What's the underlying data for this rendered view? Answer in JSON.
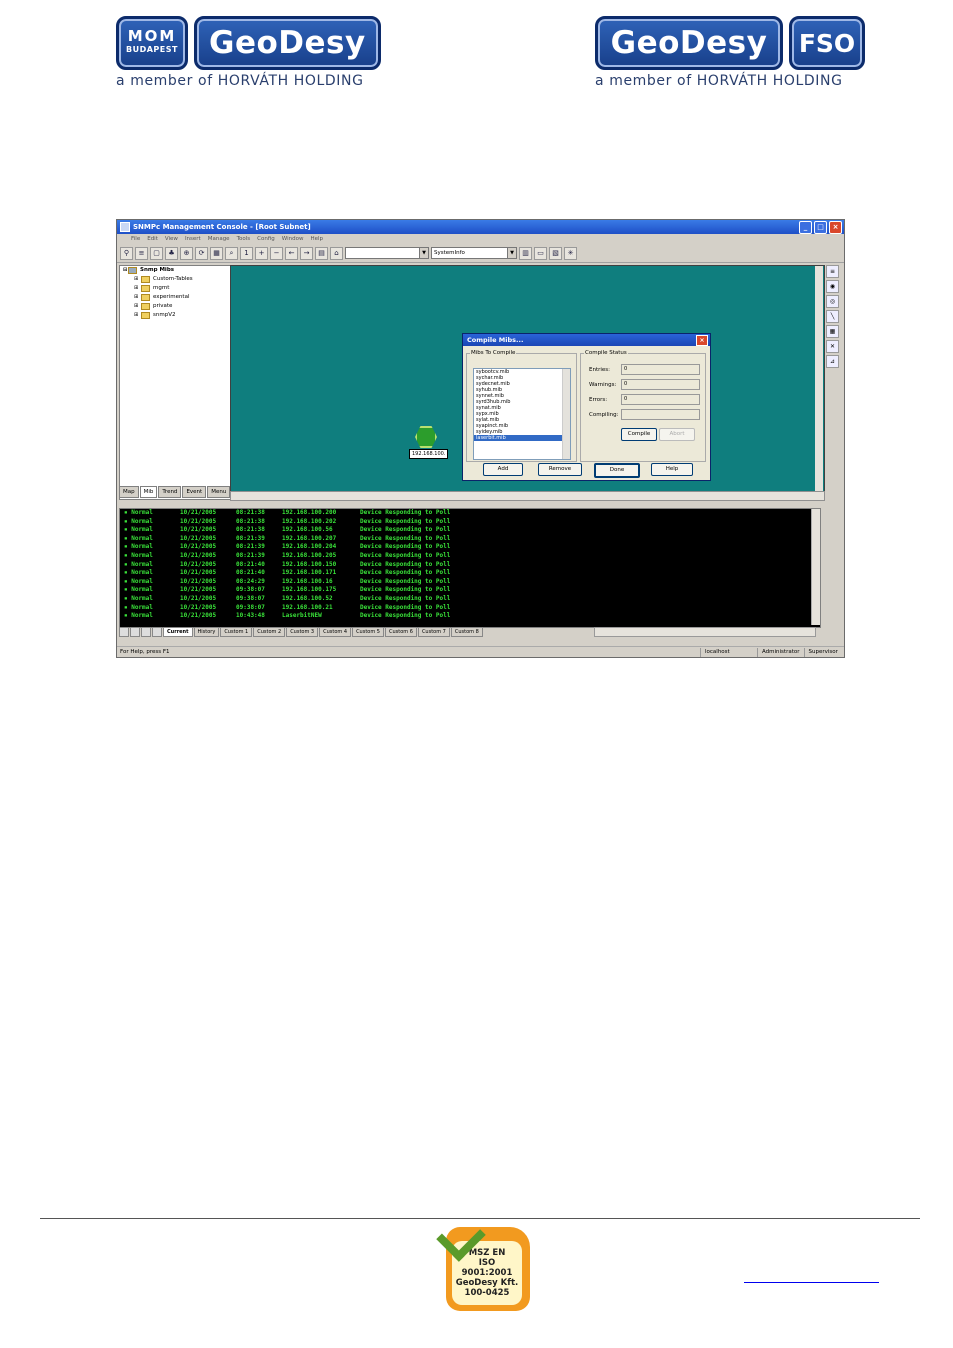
{
  "header": {
    "logo_left": {
      "mom_top": "MOM",
      "mom_bottom": "BUDAPEST",
      "brand": "GeoDesy",
      "tagline": "a member of HORVÁTH HOLDING"
    },
    "logo_right": {
      "brand": "GeoDesy",
      "suffix": "FSO",
      "tagline": "a member of HORVÁTH HOLDING"
    }
  },
  "window": {
    "title": "SNMPc Management Console - [Root Subnet]",
    "menu": [
      "File",
      "Edit",
      "View",
      "Insert",
      "Manage",
      "Tools",
      "Config",
      "Window",
      "Help"
    ],
    "toolbar_combo_value": "SystemInfo",
    "tree": {
      "root": "Snmp Mibs",
      "items": [
        "Custom-Tables",
        "mgmt",
        "experimental",
        "private",
        "snmpV2"
      ]
    },
    "left_tabs": [
      "Map",
      "Mib",
      "Trend",
      "Event",
      "Menu"
    ],
    "device_label": "192.168.100.",
    "dialog": {
      "title": "Compile Mibs...",
      "list_title": "Mibs To Compile",
      "mibs": [
        "sybootcv.mib",
        "sychar.mib",
        "sydecnet.mib",
        "syhub.mib",
        "synnet.mib",
        "syrd3hub.mib",
        "synat.mib",
        "sypx.mib",
        "sylat.mib",
        "syapinct.mib",
        "syidey.mib",
        "laserbit.mib"
      ],
      "status_title": "Compile Status",
      "entries_label": "Entries:",
      "entries_value": "0",
      "warnings_label": "Warnings:",
      "warnings_value": "0",
      "errors_label": "Errors:",
      "errors_value": "0",
      "compiling_label": "Compiling:",
      "compiling_value": "",
      "compile_btn": "Compile",
      "abort_btn": "Abort",
      "add_btn": "Add",
      "remove_btn": "Remove",
      "done_btn": "Done",
      "help_btn": "Help"
    },
    "log": {
      "rows": [
        [
          "▪ Normal",
          "10/21/2005",
          "08:21:38",
          "192.168.100.200",
          "Device Responding to Poll"
        ],
        [
          "▪ Normal",
          "10/21/2005",
          "08:21:38",
          "192.168.100.202",
          "Device Responding to Poll"
        ],
        [
          "▪ Normal",
          "10/21/2005",
          "08:21:38",
          "192.168.100.56",
          "Device Responding to Poll"
        ],
        [
          "▪ Normal",
          "10/21/2005",
          "08:21:39",
          "192.168.100.207",
          "Device Responding to Poll"
        ],
        [
          "▪ Normal",
          "10/21/2005",
          "08:21:39",
          "192.168.100.204",
          "Device Responding to Poll"
        ],
        [
          "▪ Normal",
          "10/21/2005",
          "08:21:39",
          "192.168.100.205",
          "Device Responding to Poll"
        ],
        [
          "▪ Normal",
          "10/21/2005",
          "08:21:40",
          "192.168.100.150",
          "Device Responding to Poll"
        ],
        [
          "▪ Normal",
          "10/21/2005",
          "08:21:40",
          "192.168.100.171",
          "Device Responding to Poll"
        ],
        [
          "▪ Normal",
          "10/21/2005",
          "08:24:29",
          "192.168.100.16",
          "Device Responding to Poll"
        ],
        [
          "▪ Normal",
          "10/21/2005",
          "09:38:07",
          "192.168.100.175",
          "Device Responding to Poll"
        ],
        [
          "▪ Normal",
          "10/21/2005",
          "09:38:07",
          "192.168.100.52",
          "Device Responding to Poll"
        ],
        [
          "▪ Normal",
          "10/21/2005",
          "09:38:07",
          "192.168.100.21",
          "Device Responding to Poll"
        ],
        [
          "▪ Normal",
          "10/21/2005",
          "10:43:48",
          "LaserbitNEW",
          "Device Responding to Poll"
        ]
      ]
    },
    "bottom_tabs": [
      "Current",
      "History",
      "Custom 1",
      "Custom 2",
      "Custom 3",
      "Custom 4",
      "Custom 5",
      "Custom 6",
      "Custom 7",
      "Custom 8"
    ],
    "status": {
      "help": "For Help, press F1",
      "host": "localhost",
      "user": "Administrator",
      "role": "Supervisor"
    }
  },
  "footer": {
    "cert_lines": [
      "MSZ EN",
      "ISO 9001:2001",
      "GeoDesy Kft.",
      "100-0425"
    ]
  },
  "colors": {
    "brand_blue": "#1f4fa3",
    "map_teal": "#0f7e7e",
    "log_green": "#39e039",
    "cert_orange": "#f29a1f"
  }
}
